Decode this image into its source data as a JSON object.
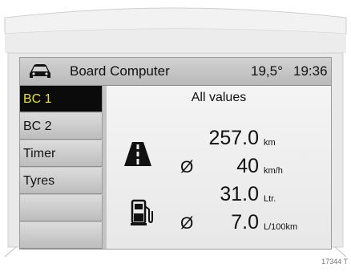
{
  "header": {
    "title": "Board Computer",
    "temperature": "19,5°",
    "time": "19:36"
  },
  "sidebar": {
    "items": [
      {
        "label": "BC 1",
        "active": true
      },
      {
        "label": "BC 2",
        "active": false
      },
      {
        "label": "Timer",
        "active": false
      },
      {
        "label": "Tyres",
        "active": false
      },
      {
        "label": "",
        "active": false
      },
      {
        "label": "",
        "active": false
      }
    ]
  },
  "main": {
    "title": "All values",
    "distance": {
      "value": "257.0",
      "unit": "km"
    },
    "avg_speed": {
      "symbol": "Ø",
      "value": "40",
      "unit": "km/h"
    },
    "fuel_used": {
      "value": "31.0",
      "unit": "Ltr."
    },
    "avg_consumption": {
      "symbol": "Ø",
      "value": "7.0",
      "unit": "L/100km"
    }
  },
  "icons": {
    "car": "car-icon",
    "road": "road-icon",
    "fuel": "fuel-pump-icon"
  },
  "colors": {
    "active_bg": "#0b0b0b",
    "active_text": "#e8e21c"
  },
  "figure_id": "17344 T"
}
